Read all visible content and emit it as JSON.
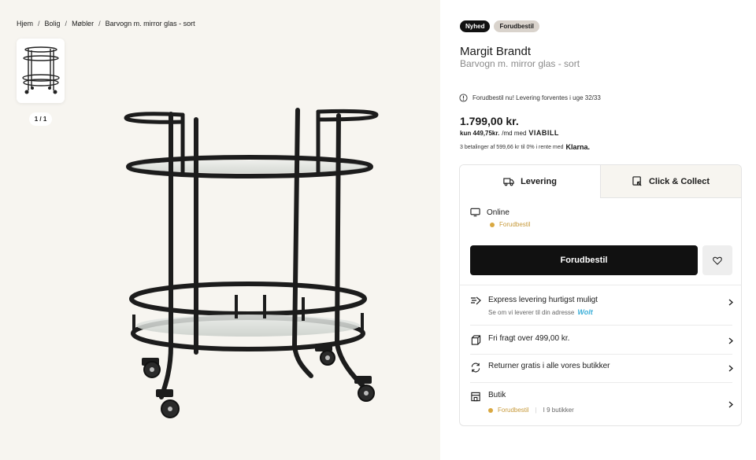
{
  "breadcrumb": [
    "Hjem",
    "Bolig",
    "Møbler",
    "Barvogn m. mirror glas - sort"
  ],
  "gallery": {
    "counter": "1 / 1"
  },
  "badges": {
    "new": "Nyhed",
    "preorder": "Forudbestil"
  },
  "product": {
    "brand": "Margit Brandt",
    "name": "Barvogn m. mirror glas - sort",
    "notice": "Forudbestil nu! Levering forventes i uge 32/33",
    "price": "1.799,00 kr.",
    "viabill_amount": "kun 449,75kr.",
    "viabill_text": "/md med",
    "viabill_logo": "VIABILL",
    "klarna_text": "3 betalinger af 599,66 kr til 0% i rente med",
    "klarna_logo": "Klarna."
  },
  "tabs": {
    "delivery": "Levering",
    "collect": "Click & Collect"
  },
  "online": {
    "label": "Online",
    "status": "Forudbestil"
  },
  "cta": {
    "label": "Forudbestil"
  },
  "rows": {
    "express": {
      "title": "Express levering hurtigst muligt",
      "sub": "Se om vi leverer til din adresse",
      "brand": "Wolt"
    },
    "freight": {
      "title": "Fri fragt over 499,00 kr."
    },
    "returns": {
      "title": "Returner gratis i alle vores butikker"
    },
    "store": {
      "title": "Butik",
      "status": "Forudbestil",
      "count": "I 9 butikker"
    }
  },
  "colors": {
    "accent": "#d9a841",
    "dark": "#111111",
    "background": "#f7f5f0"
  },
  "icons": [
    "info-icon",
    "truck-icon",
    "click-collect-icon",
    "monitor-icon",
    "heart-icon",
    "express-icon",
    "box-icon",
    "return-icon",
    "store-icon",
    "chevron-right-icon"
  ]
}
